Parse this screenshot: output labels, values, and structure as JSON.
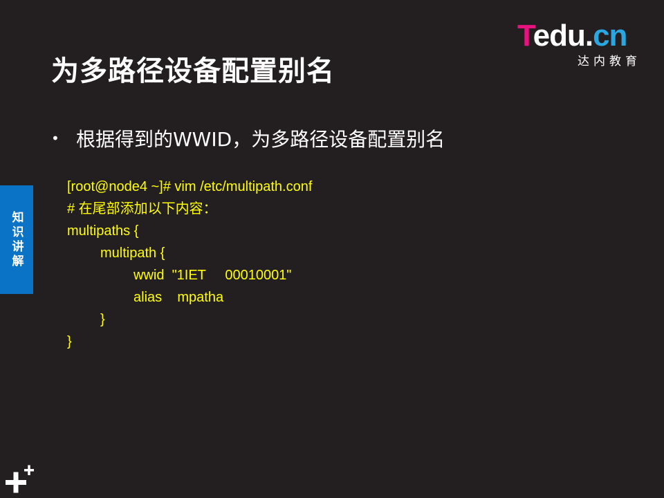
{
  "slide": {
    "title": "为多路径设备配置别名",
    "bullet": "根据得到的WWID，为多路径设备配置别名"
  },
  "logo": {
    "letter_t": "T",
    "rest": "edu.",
    "cn": "cn",
    "subtitle": "达内教育",
    "colors": {
      "t": "#e8127f",
      "cn": "#2aa6e0"
    }
  },
  "side_tab": {
    "label": "知识讲解",
    "color": "#0a73c6"
  },
  "code": {
    "color": "#ffff00",
    "lines": [
      "[root@node4 ~]# vim /etc/multipath.conf",
      "# 在尾部添加以下内容：",
      "multipaths {",
      "multipath {",
      "wwid  \"1IET     00010001\"",
      "alias    mpatha",
      "}",
      "}"
    ]
  },
  "corner_icon": "plus-plus-icon"
}
